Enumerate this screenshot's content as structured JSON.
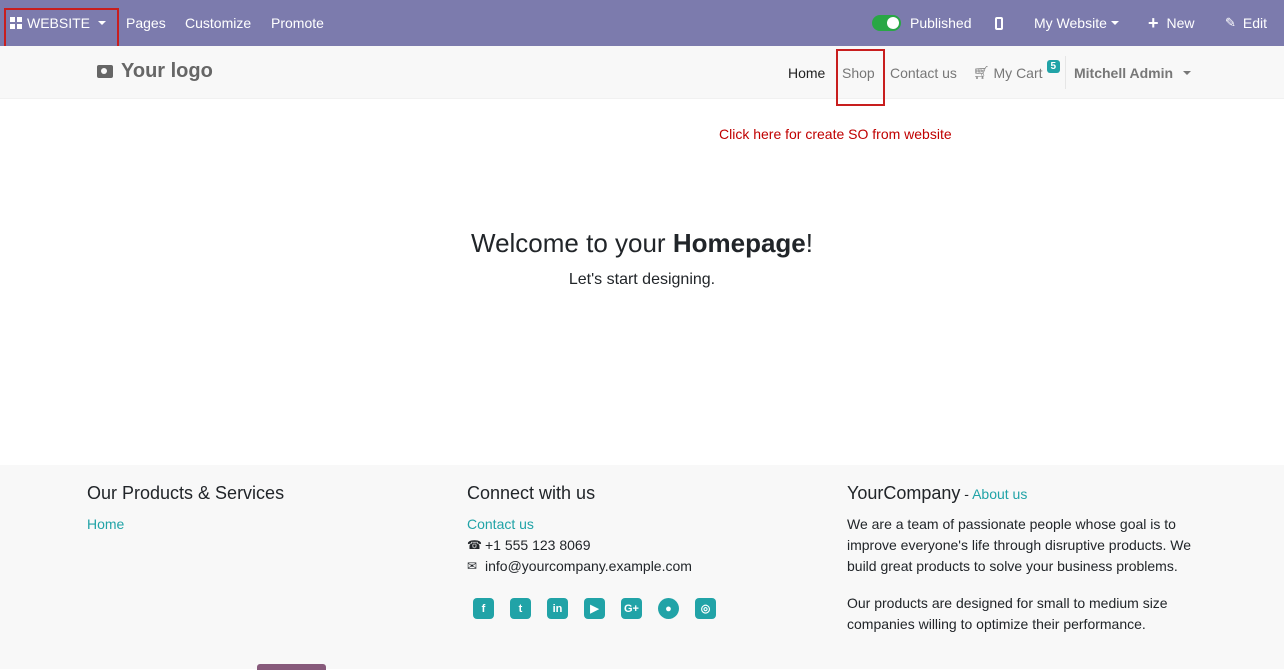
{
  "adminbar": {
    "app_menu_label": "WEBSITE",
    "pages_label": "Pages",
    "customize_label": "Customize",
    "promote_label": "Promote",
    "published_label": "Published",
    "my_website_label": "My Website",
    "new_label": "New",
    "edit_label": "Edit"
  },
  "navbar": {
    "logo_text": "Your logo",
    "home_label": "Home",
    "shop_label": "Shop",
    "contact_label": "Contact us",
    "cart_label": "My Cart",
    "cart_count": "5",
    "user_label": "Mitchell Admin"
  },
  "main": {
    "so_link": "Click here for create SO from website",
    "welcome_prefix": "Welcome to your ",
    "welcome_bold": "Homepage",
    "welcome_suffix": "!",
    "tagline": "Let's start designing."
  },
  "footer": {
    "col1_title": "Our Products & Services",
    "col1_home": "Home",
    "col2_title": "Connect with us",
    "col2_contact": "Contact us",
    "phone": "+1 555 123 8069",
    "email": "info@yourcompany.example.com",
    "social_icons": [
      "facebook-icon",
      "twitter-icon",
      "linkedin-icon",
      "youtube-icon",
      "google-plus-icon",
      "github-icon",
      "instagram-icon"
    ],
    "col3_title": "YourCompany",
    "col3_dash": " - ",
    "col3_about": "About us",
    "col3_p1": "We are a team of passionate people whose goal is to improve everyone's life through disruptive products. We build great products to solve your business problems.",
    "col3_p2": "Our products are designed for small to medium size companies willing to optimize their performance."
  },
  "colors": {
    "adminbar_bg": "#7c7bad",
    "accent": "#21a3a7",
    "so_link": "#c00000",
    "highlight_box": "#c81e1e"
  }
}
